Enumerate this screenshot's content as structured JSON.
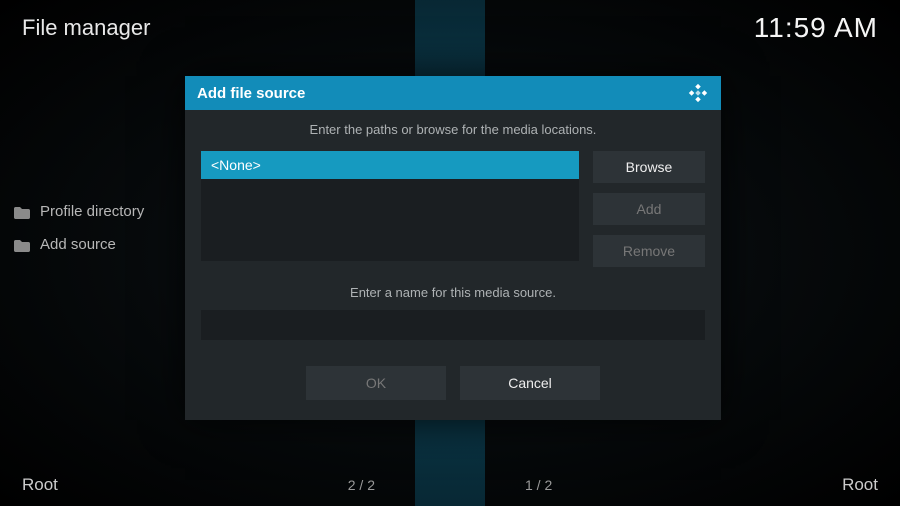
{
  "header": {
    "title": "File manager",
    "clock": "11:59 AM"
  },
  "sidebar": {
    "items": [
      {
        "label": "Profile directory"
      },
      {
        "label": "Add source"
      }
    ]
  },
  "dialog": {
    "title": "Add file source",
    "instruction_paths": "Enter the paths or browse for the media locations.",
    "selected_path": "<None>",
    "browse_label": "Browse",
    "add_label": "Add",
    "remove_label": "Remove",
    "instruction_name": "Enter a name for this media source.",
    "name_value": "",
    "ok_label": "OK",
    "cancel_label": "Cancel"
  },
  "footer": {
    "left_root": "Root",
    "right_root": "Root",
    "left_counter": "2 / 2",
    "right_counter": "1 / 2"
  }
}
